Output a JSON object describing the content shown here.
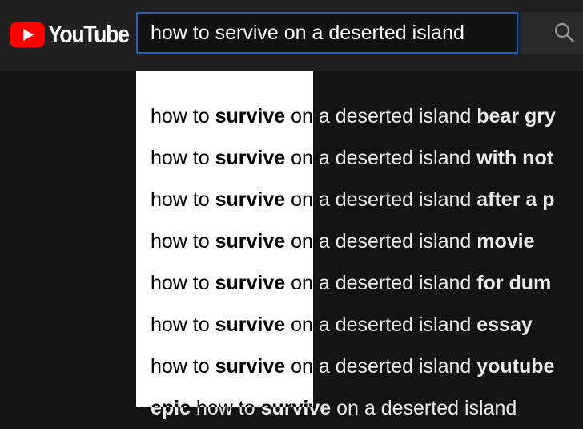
{
  "header": {
    "logo_text": "YouTube",
    "search": {
      "value": "how to servive on a deserted island"
    }
  },
  "colors": {
    "brand_red": "#ff0000",
    "focus_border": "#1c62b9"
  },
  "suggestions": [
    {
      "pre": "how to ",
      "bold": "survive",
      "mid": " on a deserted island ",
      "tail": "bear gry"
    },
    {
      "pre": "how to ",
      "bold": "survive",
      "mid": " on a deserted island ",
      "tail": "with not"
    },
    {
      "pre": "how to ",
      "bold": "survive",
      "mid": " on a deserted island ",
      "tail": "after a p"
    },
    {
      "pre": "how to ",
      "bold": "survive",
      "mid": " on a deserted island ",
      "tail": "movie"
    },
    {
      "pre": "how to ",
      "bold": "survive",
      "mid": " on a deserted island ",
      "tail": "for dum"
    },
    {
      "pre": "how to ",
      "bold": "survive",
      "mid": " on a deserted island ",
      "tail": "essay"
    },
    {
      "pre": "how to ",
      "bold": "survive",
      "mid": " on a deserted island ",
      "tail": "youtube"
    },
    {
      "pre": "epic",
      "bold": " how to ",
      "mid": "survive",
      "tail": " on a deserted island"
    }
  ]
}
